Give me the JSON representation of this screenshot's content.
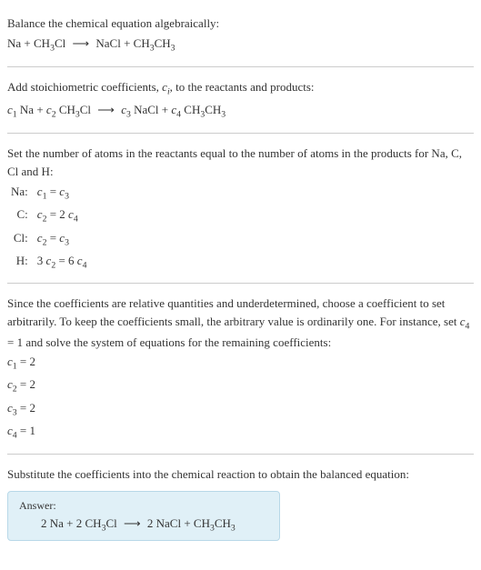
{
  "section1": {
    "title": "Balance the chemical equation algebraically:",
    "equation": "Na + CH₃Cl  ⟶  NaCl + CH₃CH₃"
  },
  "section2": {
    "title_a": "Add stoichiometric coefficients, ",
    "title_ci": "cᵢ",
    "title_b": ", to the reactants and products:",
    "equation": "c₁ Na + c₂ CH₃Cl  ⟶  c₃ NaCl + c₄ CH₃CH₃"
  },
  "section3": {
    "title": "Set the number of atoms in the reactants equal to the number of atoms in the products for Na, C, Cl and H:",
    "rows": [
      {
        "el": "Na:",
        "eq": "c₁ = c₃"
      },
      {
        "el": "C:",
        "eq": "c₂ = 2 c₄"
      },
      {
        "el": "Cl:",
        "eq": "c₂ = c₃"
      },
      {
        "el": "H:",
        "eq": "3 c₂ = 6 c₄"
      }
    ]
  },
  "section4": {
    "text": "Since the coefficients are relative quantities and underdetermined, choose a coefficient to set arbitrarily. To keep the coefficients small, the arbitrary value is ordinarily one. For instance, set c₄ = 1 and solve the system of equations for the remaining coefficients:",
    "solns": [
      "c₁ = 2",
      "c₂ = 2",
      "c₃ = 2",
      "c₄ = 1"
    ]
  },
  "section5": {
    "text": "Substitute the coefficients into the chemical reaction to obtain the balanced equation:",
    "answer_label": "Answer:",
    "answer_eq": "2 Na + 2 CH₃Cl  ⟶  2 NaCl + CH₃CH₃"
  }
}
